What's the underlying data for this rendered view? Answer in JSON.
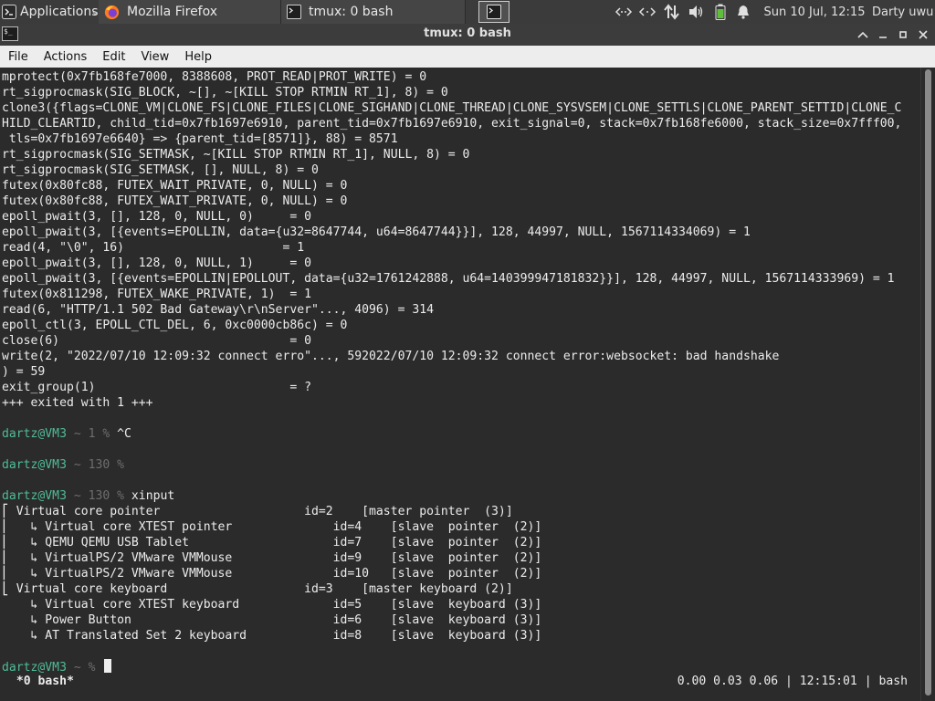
{
  "panel": {
    "applications_label": "Applications",
    "tasks": [
      {
        "label": "Mozilla Firefox",
        "icon": "firefox-icon"
      },
      {
        "label": "tmux: 0 bash",
        "icon": "terminal-icon"
      }
    ],
    "clock": "Sun 10 Jul, 12:15",
    "user": "Darty uwu"
  },
  "window": {
    "title": "tmux: 0 bash",
    "controls": [
      "maximize-chevron",
      "minimize",
      "restore",
      "close"
    ]
  },
  "menubar": {
    "items": [
      "File",
      "Actions",
      "Edit",
      "View",
      "Help"
    ]
  },
  "terminal": {
    "lines": [
      "mprotect(0x7fb168fe7000, 8388608, PROT_READ|PROT_WRITE) = 0",
      "rt_sigprocmask(SIG_BLOCK, ~[], ~[KILL STOP RTMIN RT_1], 8) = 0",
      "clone3({flags=CLONE_VM|CLONE_FS|CLONE_FILES|CLONE_SIGHAND|CLONE_THREAD|CLONE_SYSVSEM|CLONE_SETTLS|CLONE_PARENT_SETTID|CLONE_C",
      "HILD_CLEARTID, child_tid=0x7fb1697e6910, parent_tid=0x7fb1697e6910, exit_signal=0, stack=0x7fb168fe6000, stack_size=0x7fff00,",
      " tls=0x7fb1697e6640} => {parent_tid=[8571]}, 88) = 8571",
      "rt_sigprocmask(SIG_SETMASK, ~[KILL STOP RTMIN RT_1], NULL, 8) = 0",
      "rt_sigprocmask(SIG_SETMASK, [], NULL, 8) = 0",
      "futex(0x80fc88, FUTEX_WAIT_PRIVATE, 0, NULL) = 0",
      "futex(0x80fc88, FUTEX_WAIT_PRIVATE, 0, NULL) = 0",
      "epoll_pwait(3, [], 128, 0, NULL, 0)     = 0",
      "epoll_pwait(3, [{events=EPOLLIN, data={u32=8647744, u64=8647744}}], 128, 44997, NULL, 1567114334069) = 1",
      "read(4, \"\\0\", 16)                      = 1",
      "epoll_pwait(3, [], 128, 0, NULL, 1)     = 0",
      "epoll_pwait(3, [{events=EPOLLIN|EPOLLOUT, data={u32=1761242888, u64=140399947181832}}], 128, 44997, NULL, 1567114333969) = 1",
      "futex(0x811298, FUTEX_WAKE_PRIVATE, 1)  = 1",
      "read(6, \"HTTP/1.1 502 Bad Gateway\\r\\nServer\"..., 4096) = 314",
      "epoll_ctl(3, EPOLL_CTL_DEL, 6, 0xc0000cb86c) = 0",
      "close(6)                                = 0",
      "write(2, \"2022/07/10 12:09:32 connect erro\"..., 592022/07/10 12:09:32 connect error:websocket: bad handshake",
      ") = 59",
      "exit_group(1)                           = ?",
      "+++ exited with 1 +++"
    ],
    "prompts": [
      {
        "user": "dartz@VM3",
        "sep": " ~ ",
        "code": "1 % ",
        "command": "^C"
      },
      {
        "user": "dartz@VM3",
        "sep": " ~ ",
        "code": "130 % ",
        "command": ""
      },
      {
        "user": "dartz@VM3",
        "sep": " ~ ",
        "code": "130 % ",
        "command": "xinput"
      }
    ],
    "xinput_lines": [
      "⎡ Virtual core pointer                    id=2    [master pointer  (3)]",
      "⎜   ↳ Virtual core XTEST pointer              id=4    [slave  pointer  (2)]",
      "⎜   ↳ QEMU QEMU USB Tablet                    id=7    [slave  pointer  (2)]",
      "⎜   ↳ VirtualPS/2 VMware VMMouse              id=9    [slave  pointer  (2)]",
      "⎜   ↳ VirtualPS/2 VMware VMMouse              id=10   [slave  pointer  (2)]",
      "⎣ Virtual core keyboard                   id=3    [master keyboard (2)]",
      "    ↳ Virtual core XTEST keyboard             id=5    [slave  keyboard (3)]",
      "    ↳ Power Button                            id=6    [slave  keyboard (3)]",
      "    ↳ AT Translated Set 2 keyboard            id=8    [slave  keyboard (3)]"
    ],
    "final_prompt": {
      "user": "dartz@VM3",
      "sep": " ~ ",
      "code": "% "
    },
    "status": {
      "left": " *0 bash*",
      "right": "0.00 0.03 0.06 | 12:15:01 | bash"
    }
  },
  "colors": {
    "terminal_bg": "#2b2b2b",
    "terminal_fg": "#ececec",
    "prompt_user": "#4fbc96",
    "prompt_code": "#6e6e6e",
    "panel_bg": "#3b3b3b",
    "menubar_bg": "#ededed"
  }
}
